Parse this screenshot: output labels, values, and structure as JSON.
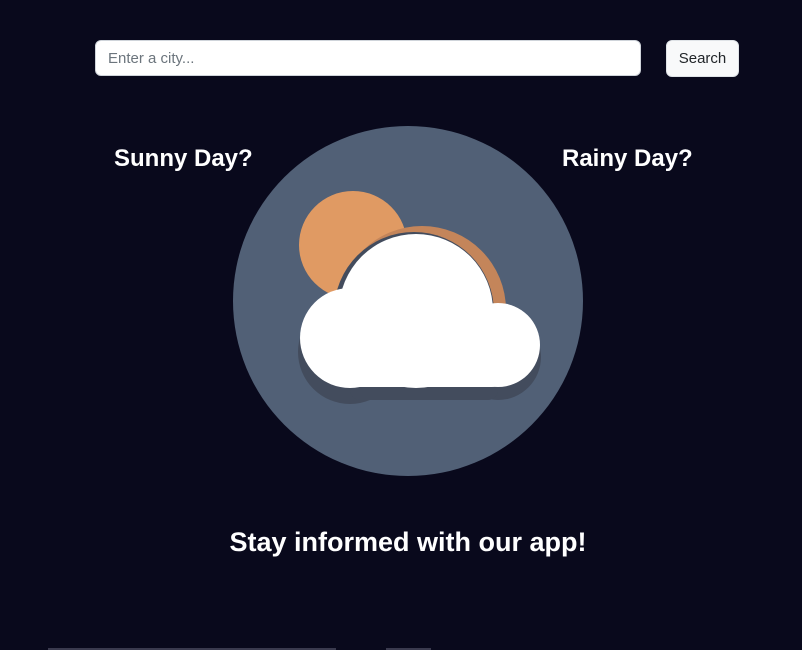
{
  "search": {
    "placeholder": "Enter a city...",
    "value": "",
    "button_label": "Search"
  },
  "hero": {
    "left_label": "Sunny Day?",
    "right_label": "Rainy Day?",
    "illustration_icon": "sun-behind-cloud-icon",
    "tagline": "Stay informed with our app!"
  },
  "colors": {
    "background": "#09091c",
    "circle": "#516076",
    "sun": "#e09a63",
    "sun_shadow": "#c4855a",
    "cloud": "#ffffff",
    "cloud_shadow": "#434c5d"
  }
}
